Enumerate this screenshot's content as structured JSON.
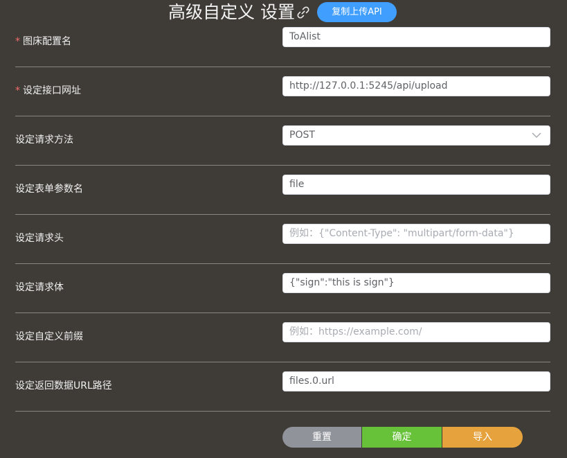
{
  "header": {
    "title": "高级自定义 设置",
    "copy_button_label": "复制上传API",
    "link_icon": "link-icon"
  },
  "form": {
    "rows": [
      {
        "label": "图床配置名",
        "required": true,
        "value": "ToAlist",
        "placeholder": ""
      },
      {
        "label": "设定接口网址",
        "required": true,
        "value": "http://127.0.0.1:5245/api/upload",
        "placeholder": ""
      },
      {
        "label": "设定请求方法",
        "required": false,
        "value": "POST",
        "placeholder": "",
        "type": "select"
      },
      {
        "label": "设定表单参数名",
        "required": false,
        "value": "file",
        "placeholder": ""
      },
      {
        "label": "设定请求头",
        "required": false,
        "value": "",
        "placeholder": "例如：{\"Content-Type\": \"multipart/form-data\"}"
      },
      {
        "label": "设定请求体",
        "required": false,
        "value": "{\"sign\":\"this is sign\"}",
        "placeholder": ""
      },
      {
        "label": "设定自定义前缀",
        "required": false,
        "value": "",
        "placeholder": "例如：https://example.com/"
      },
      {
        "label": "设定返回数据URL路径",
        "required": false,
        "value": "files.0.url",
        "placeholder": ""
      }
    ],
    "required_mark": "*"
  },
  "actions": {
    "reset_label": "重置",
    "confirm_label": "确定",
    "import_label": "导入"
  },
  "colors": {
    "background": "#3f3b37",
    "accent_blue": "#409eff",
    "reset_gray": "#909399",
    "confirm_green": "#67c23a",
    "import_orange": "#e6a23c",
    "required_red": "#f56c6c"
  }
}
